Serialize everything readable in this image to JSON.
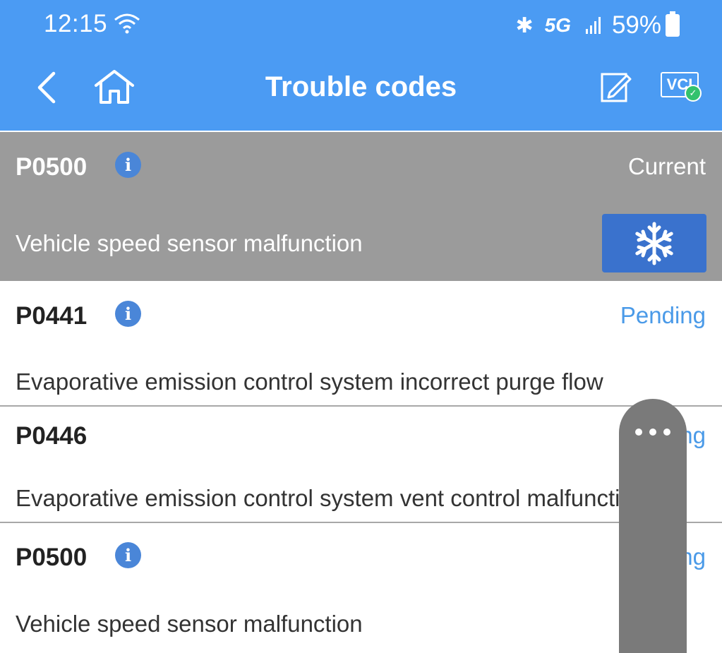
{
  "status_bar": {
    "time": "12:15",
    "network": "5G",
    "battery": "59%"
  },
  "header": {
    "title": "Trouble codes"
  },
  "codes": [
    {
      "code": "P0500",
      "status": "Current",
      "description": "Vehicle speed sensor malfunction"
    },
    {
      "code": "P0441",
      "status": "Pending",
      "description": "Evaporative emission control system incorrect purge flow"
    },
    {
      "code": "P0446",
      "status": "Pending",
      "description": "Evaporative emission control system vent control malfunction"
    },
    {
      "code": "P0500",
      "status": "Pending",
      "description": "Vehicle speed sensor malfunction"
    }
  ],
  "icons": {
    "back": "chevron-left-icon",
    "home": "home-icon",
    "edit": "edit-report-icon",
    "vci": "vci-icon",
    "info": "info-icon",
    "freeze": "snowflake-icon",
    "menu": "more-dots-icon"
  },
  "colors": {
    "header": "#4b9bf3",
    "selected_row": "#9b9b9b",
    "pending": "#4a9ae8",
    "freeze_button": "#3a72cd"
  }
}
